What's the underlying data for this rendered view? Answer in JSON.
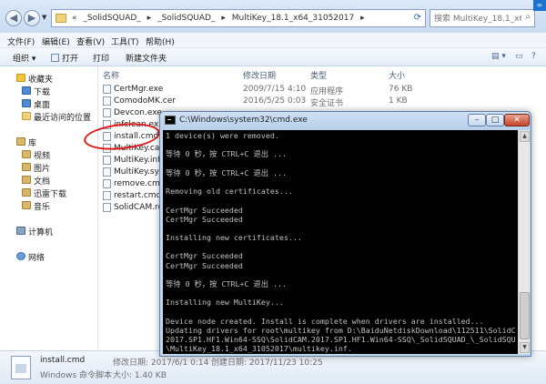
{
  "explorer": {
    "breadcrumbs": [
      "«",
      "_SolidSQUAD_",
      "▸",
      "_SolidSQUAD_",
      "▸",
      "MultiKey_18.1_x64_31052017",
      "▸"
    ],
    "search_placeholder": "搜索 MultiKey_18.1_x64_...",
    "menu": [
      "文件(F)",
      "编辑(E)",
      "查看(V)",
      "工具(T)",
      "帮助(H)"
    ],
    "toolbar": [
      "组织 ▾",
      "打开",
      "打印",
      "新建文件夹"
    ],
    "sidebar": {
      "favorites": "收藏夹",
      "favorites_items": [
        "下载",
        "桌面",
        "最近访问的位置"
      ],
      "libraries": "库",
      "libraries_items": [
        "视频",
        "图片",
        "文档",
        "迅雷下载",
        "音乐"
      ],
      "computer": "计算机",
      "network": "网络"
    },
    "columns": {
      "name": "名称",
      "date": "修改日期",
      "type": "类型",
      "size": "大小"
    },
    "files": [
      {
        "name": "CertMgr.exe",
        "date": "2009/7/15 4:10",
        "type": "应用程序",
        "size": "76 KB"
      },
      {
        "name": "ComodoMK.cer",
        "date": "2016/5/25 0:03",
        "type": "安全证书",
        "size": "1 KB"
      },
      {
        "name": "Devcon.exe",
        "date": "",
        "type": "",
        "size": ""
      },
      {
        "name": "infclean.ex",
        "date": "",
        "type": "",
        "size": ""
      },
      {
        "name": "install.cmd",
        "date": "",
        "type": "",
        "size": ""
      },
      {
        "name": "MultiKey.cat",
        "date": "",
        "type": "",
        "size": ""
      },
      {
        "name": "MultiKey.inf",
        "date": "",
        "type": "",
        "size": ""
      },
      {
        "name": "MultiKey.sys",
        "date": "",
        "type": "",
        "size": ""
      },
      {
        "name": "remove.cmd",
        "date": "",
        "type": "",
        "size": ""
      },
      {
        "name": "restart.cmd",
        "date": "",
        "type": "",
        "size": ""
      },
      {
        "name": "SolidCAM.reg",
        "date": "",
        "type": "",
        "size": ""
      }
    ],
    "details": {
      "name": "install.cmd",
      "type": "Windows 命令脚本",
      "modified": "修改日期: 2017/6/1 0:14",
      "created": "创建日期: 2017/11/23 10:25",
      "size": "大小: 1.40 KB"
    }
  },
  "cmd": {
    "title": "C:\\Windows\\system32\\cmd.exe",
    "buttons": {
      "minimize": "–",
      "maximize": "□",
      "close": "✕"
    },
    "lines": [
      "1 device(s) were removed.",
      "",
      "等待 0 秒，按 CTRL+C 退出 ...",
      "",
      "等待 0 秒，按 CTRL+C 退出 ...",
      "",
      "Removing old certificates...",
      "",
      "CertMgr Succeeded",
      "CertMgr Succeeded",
      "",
      "Installing new certificates...",
      "",
      "CertMgr Succeeded",
      "CertMgr Succeeded",
      "",
      "等待 0 秒，按 CTRL+C 退出 ...",
      "",
      "Installing new MultiKey...",
      "",
      "Device node created. Install is complete when drivers are installed...",
      "Updating drivers for root\\multikey from D:\\BaiduNetdiskDownload\\112511\\SolidCAM.",
      "2017.SP1.HF1.Win64-SSQ\\SolidCAM.2017.SP1.HF1.Win64-SSQ\\_SolidSQUAD_\\_SolidSQUAD_",
      "\\MultiKey_18.1_x64_31052017\\multikey.inf."
    ]
  }
}
